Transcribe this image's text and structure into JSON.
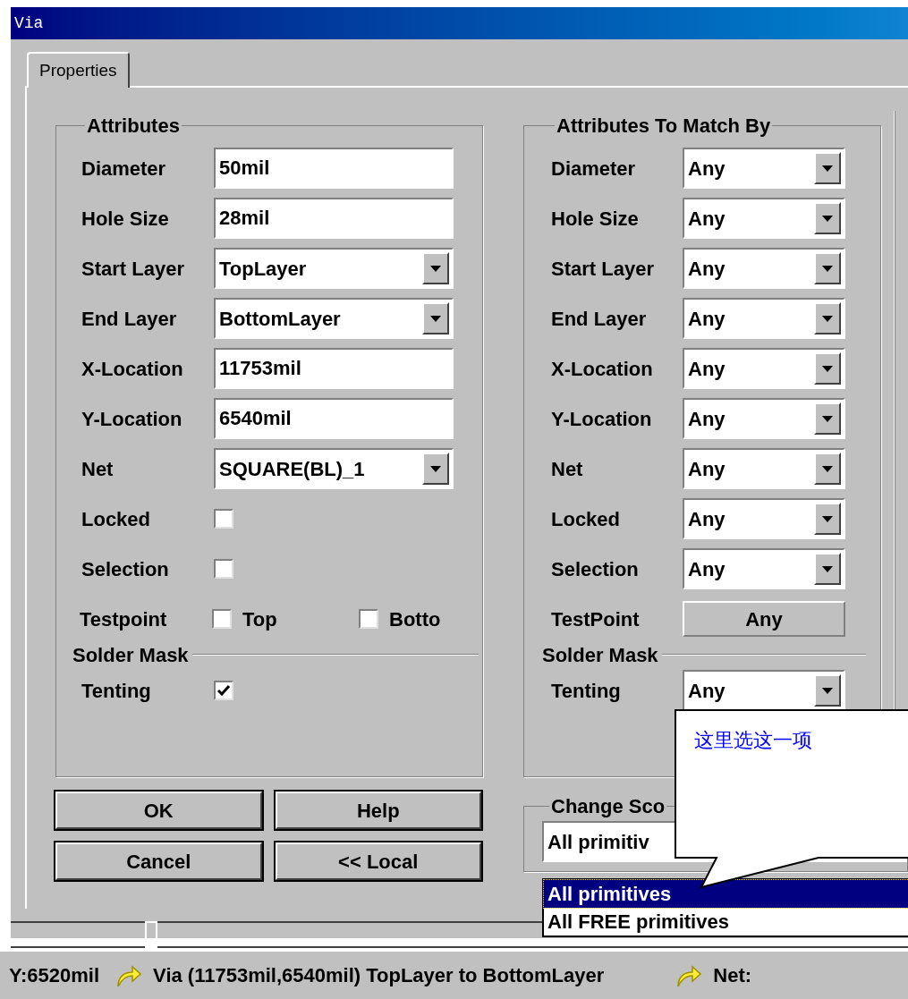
{
  "window": {
    "title": "Via"
  },
  "tabs": [
    {
      "label": "Properties",
      "selected": true
    }
  ],
  "attributes": {
    "title": "Attributes",
    "rows": [
      {
        "kind": "text",
        "label": "Diameter",
        "value": "50mil"
      },
      {
        "kind": "text",
        "label": "Hole Size",
        "value": "28mil"
      },
      {
        "kind": "combo",
        "label": "Start Layer",
        "value": "TopLayer"
      },
      {
        "kind": "combo",
        "label": "End Layer",
        "value": "BottomLayer"
      },
      {
        "kind": "text",
        "label": "X-Location",
        "value": "11753mil"
      },
      {
        "kind": "text",
        "label": "Y-Location",
        "value": "6540mil"
      },
      {
        "kind": "combo",
        "label": "Net",
        "value": "SQUARE(BL)_1"
      },
      {
        "kind": "check",
        "label": "Locked",
        "checked": false
      },
      {
        "kind": "check",
        "label": "Selection",
        "checked": false
      },
      {
        "kind": "checks",
        "label": "Testpoint",
        "options": [
          {
            "label": "Top",
            "checked": false
          },
          {
            "label": "Botto",
            "checked": false
          }
        ]
      },
      {
        "kind": "section",
        "label": "Solder Mask"
      },
      {
        "kind": "check",
        "label": "Tenting",
        "checked": true
      }
    ]
  },
  "match": {
    "title": "Attributes To Match By",
    "rows": [
      {
        "kind": "combo",
        "label": "Diameter",
        "value": "Any"
      },
      {
        "kind": "combo",
        "label": "Hole Size",
        "value": "Any"
      },
      {
        "kind": "combo",
        "label": "Start Layer",
        "value": "Any"
      },
      {
        "kind": "combo",
        "label": "End Layer",
        "value": "Any"
      },
      {
        "kind": "combo",
        "label": "X-Location",
        "value": "Any"
      },
      {
        "kind": "combo",
        "label": "Y-Location",
        "value": "Any"
      },
      {
        "kind": "combo",
        "label": "Net",
        "value": "Any"
      },
      {
        "kind": "combo",
        "label": "Locked",
        "value": "Any"
      },
      {
        "kind": "combo",
        "label": "Selection",
        "value": "Any"
      },
      {
        "kind": "button",
        "label": "TestPoint",
        "value": "Any"
      },
      {
        "kind": "section",
        "label": "Solder Mask"
      },
      {
        "kind": "combo",
        "label": "Tenting",
        "value": "Any"
      }
    ]
  },
  "buttons": [
    {
      "label": "OK"
    },
    {
      "label": "Help"
    },
    {
      "label": "Cancel"
    },
    {
      "label": "<< Local"
    }
  ],
  "change_scope": {
    "title": "Change Sco",
    "value": "All primitiv",
    "options": [
      {
        "label": "All primitives",
        "selected": true
      },
      {
        "label": "All FREE primitives",
        "selected": false
      }
    ]
  },
  "callout": {
    "text": "这里选这一项"
  },
  "status_bar": {
    "position": "Y:6520mil",
    "object": "Via (11753mil,6540mil) TopLayer to BottomLayer",
    "net": "Net:"
  }
}
